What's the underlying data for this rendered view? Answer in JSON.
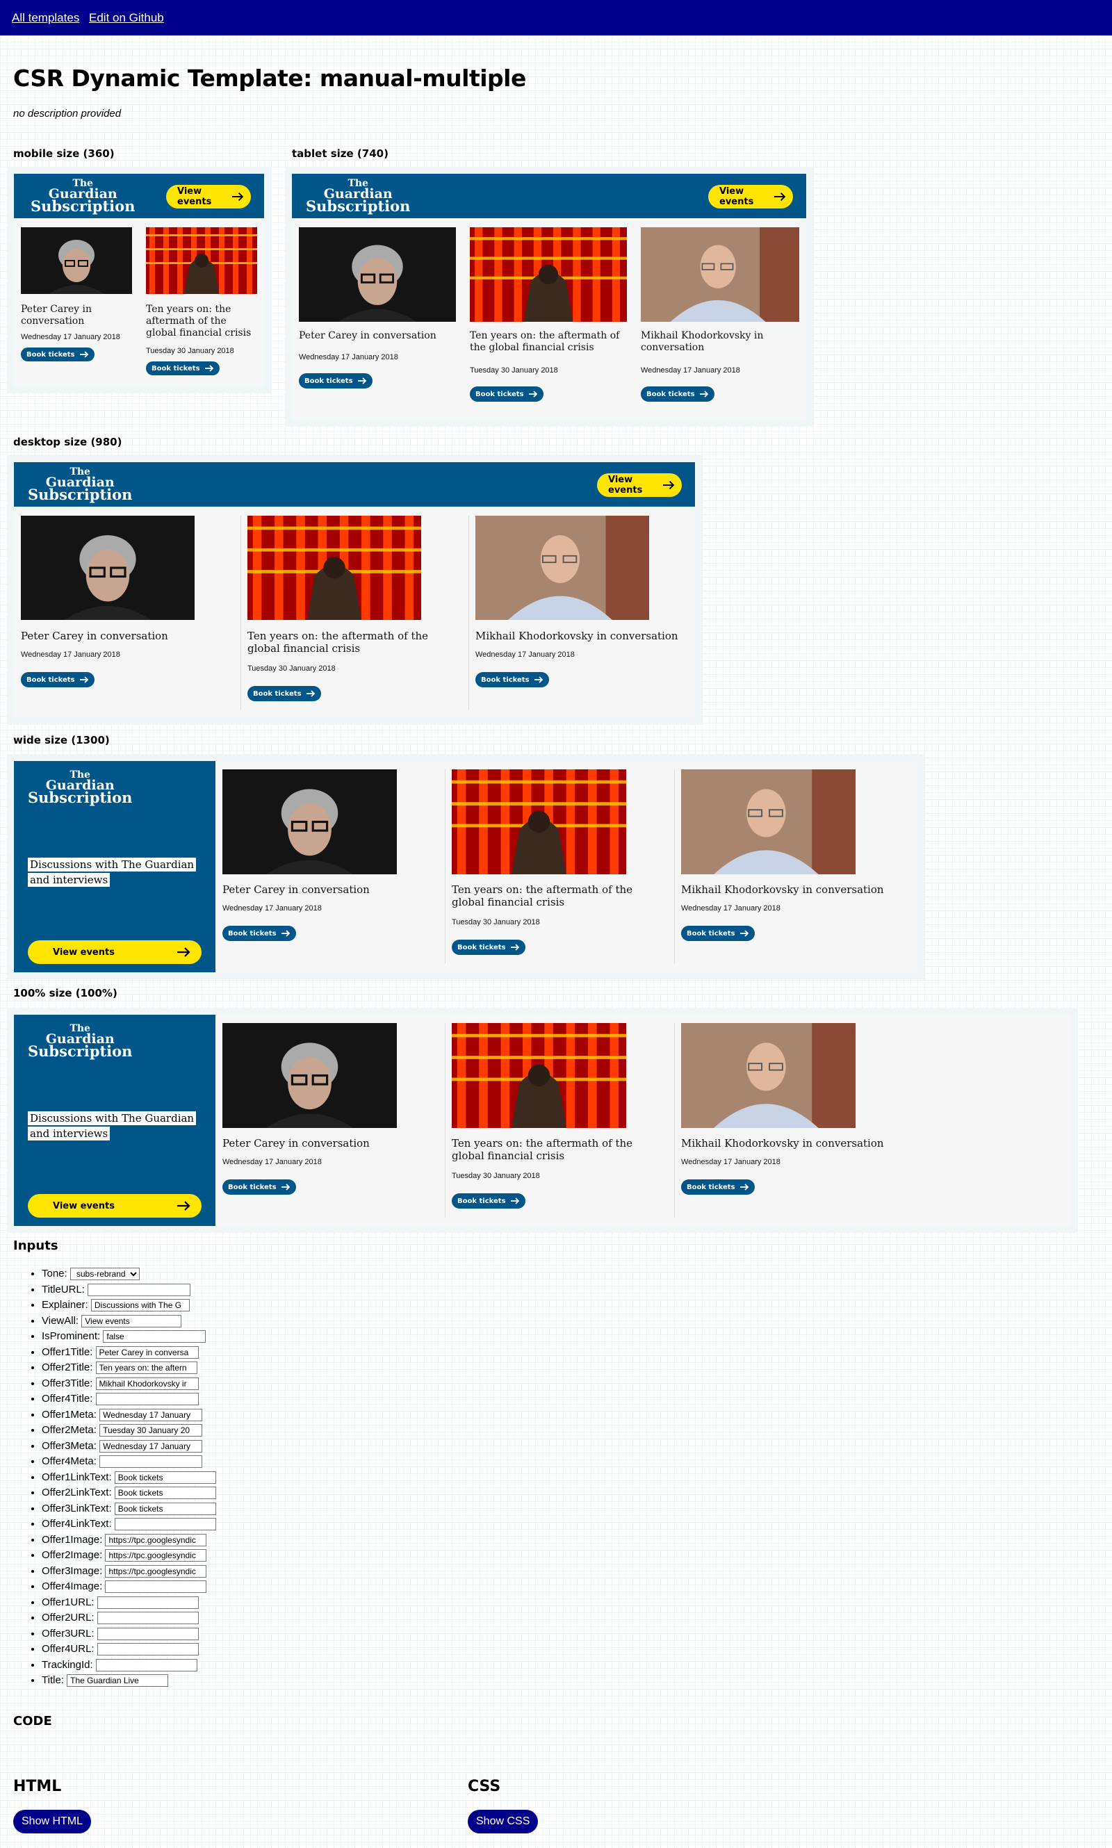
{
  "nav": {
    "all_templates": "All templates",
    "edit_github": "Edit on Github"
  },
  "page": {
    "title": "CSR Dynamic Template: manual-multiple",
    "description": "no description provided"
  },
  "sizes": {
    "mobile": "mobile size (360)",
    "tablet": "tablet size (740)",
    "desktop": "desktop size (980)",
    "wide": "wide size (1300)",
    "full": "100% size (100%)"
  },
  "brand": {
    "logo_line1": "The",
    "logo_line2": "Guardian",
    "logo_line3": "Subscription",
    "primary_color": "#005689",
    "accent_color": "#ffe500"
  },
  "view_events": "View events",
  "explainer": "Discussions with The Guardian and interviews",
  "offers": [
    {
      "title": "Peter Carey in conversation",
      "meta": "Wednesday 17 January 2018",
      "link": "Book tickets"
    },
    {
      "title": "Ten years on: the aftermath of the global financial crisis",
      "meta": "Tuesday 30 January 2018",
      "link": "Book tickets"
    },
    {
      "title": "Mikhail Khodorkovsky in conversation",
      "meta": "Wednesday 17 January 2018",
      "link": "Book tickets"
    }
  ],
  "inputs": {
    "heading": "Inputs",
    "fields": [
      {
        "label": "Tone:",
        "value": "subs-rebrand",
        "type": "select"
      },
      {
        "label": "TitleURL:",
        "value": ""
      },
      {
        "label": "Explainer:",
        "value": "Discussions with The G"
      },
      {
        "label": "ViewAll:",
        "value": "View events"
      },
      {
        "label": "IsProminent:",
        "value": "false"
      },
      {
        "label": "Offer1Title:",
        "value": "Peter Carey in conversa"
      },
      {
        "label": "Offer2Title:",
        "value": "Ten years on: the aftern"
      },
      {
        "label": "Offer3Title:",
        "value": "Mikhail Khodorkovsky ir"
      },
      {
        "label": "Offer4Title:",
        "value": ""
      },
      {
        "label": "Offer1Meta:",
        "value": "Wednesday 17 January"
      },
      {
        "label": "Offer2Meta:",
        "value": "Tuesday 30 January 20"
      },
      {
        "label": "Offer3Meta:",
        "value": "Wednesday 17 January"
      },
      {
        "label": "Offer4Meta:",
        "value": ""
      },
      {
        "label": "Offer1LinkText:",
        "value": "Book tickets"
      },
      {
        "label": "Offer2LinkText:",
        "value": "Book tickets"
      },
      {
        "label": "Offer3LinkText:",
        "value": "Book tickets"
      },
      {
        "label": "Offer4LinkText:",
        "value": ""
      },
      {
        "label": "Offer1Image:",
        "value": "https://tpc.googlesyndic"
      },
      {
        "label": "Offer2Image:",
        "value": "https://tpc.googlesyndic"
      },
      {
        "label": "Offer3Image:",
        "value": "https://tpc.googlesyndic"
      },
      {
        "label": "Offer4Image:",
        "value": ""
      },
      {
        "label": "Offer1URL:",
        "value": ""
      },
      {
        "label": "Offer2URL:",
        "value": ""
      },
      {
        "label": "Offer3URL:",
        "value": ""
      },
      {
        "label": "Offer4URL:",
        "value": ""
      },
      {
        "label": "TrackingId:",
        "value": ""
      },
      {
        "label": "Title:",
        "value": "The Guardian Live"
      }
    ]
  },
  "code": {
    "heading": "CODE",
    "html_heading": "HTML",
    "css_heading": "CSS",
    "show_html": "Show HTML",
    "show_css": "Show CSS"
  }
}
